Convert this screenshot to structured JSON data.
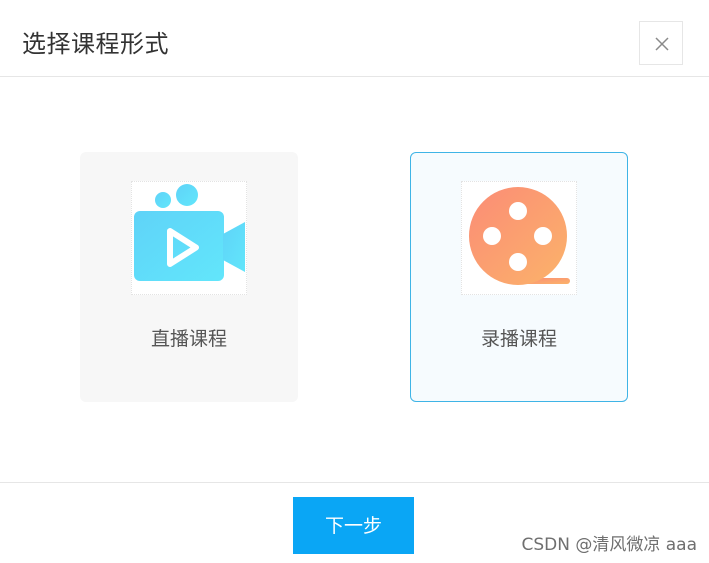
{
  "dialog": {
    "title": "选择课程形式",
    "close_icon": "close-icon"
  },
  "options": [
    {
      "label": "直播课程",
      "icon": "video-camera-icon",
      "selected": false
    },
    {
      "label": "录播课程",
      "icon": "film-reel-icon",
      "selected": true
    }
  ],
  "footer": {
    "next_label": "下一步"
  },
  "watermark": "CSDN @清风微凉 aaa",
  "colors": {
    "accent": "#0aa6f5",
    "selected_border": "#3fb4e6",
    "camera_gradient_start": "#5fd3f8",
    "camera_gradient_end": "#62e6fb",
    "reel_gradient_start": "#fb8c76",
    "reel_gradient_end": "#fbb36a"
  }
}
